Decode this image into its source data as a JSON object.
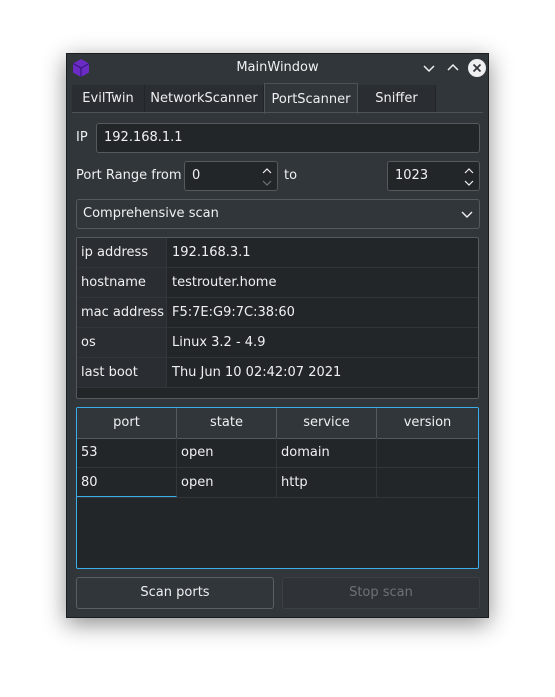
{
  "window": {
    "title": "MainWindow"
  },
  "colors": {
    "accent": "#3daee9",
    "background": "#31363b",
    "field": "#232629",
    "app_icon": "#6a2cc4"
  },
  "titlebar": {
    "icons": [
      "app-logo-icon",
      "minimize-icon",
      "maximize-icon",
      "close-icon"
    ]
  },
  "tabs": [
    {
      "label": "EvilTwin",
      "active": false
    },
    {
      "label": "NetworkScanner",
      "active": false
    },
    {
      "label": "PortScanner",
      "active": true
    },
    {
      "label": "Sniffer",
      "active": false
    }
  ],
  "ip": {
    "label": "IP",
    "value": "192.168.1.1"
  },
  "port_range": {
    "label": "Port Range from",
    "from": "0",
    "to_label": "to",
    "to": "1023"
  },
  "scan_type": {
    "selected": "Comprehensive scan"
  },
  "host_info": [
    {
      "key": "ip address",
      "value": "192.168.3.1"
    },
    {
      "key": "hostname",
      "value": "testrouter.home"
    },
    {
      "key": "mac address",
      "value": "F5:7E:G9:7C:38:60"
    },
    {
      "key": "os",
      "value": "Linux 3.2 - 4.9"
    },
    {
      "key": "last boot",
      "value": "Thu Jun 10 02:42:07 2021"
    }
  ],
  "ports_table": {
    "headers": [
      "port",
      "state",
      "service",
      "version"
    ],
    "rows": [
      [
        "53",
        "open",
        "domain",
        ""
      ],
      [
        "80",
        "open",
        "http",
        ""
      ]
    ]
  },
  "buttons": {
    "scan": "Scan ports",
    "stop": "Stop scan"
  }
}
